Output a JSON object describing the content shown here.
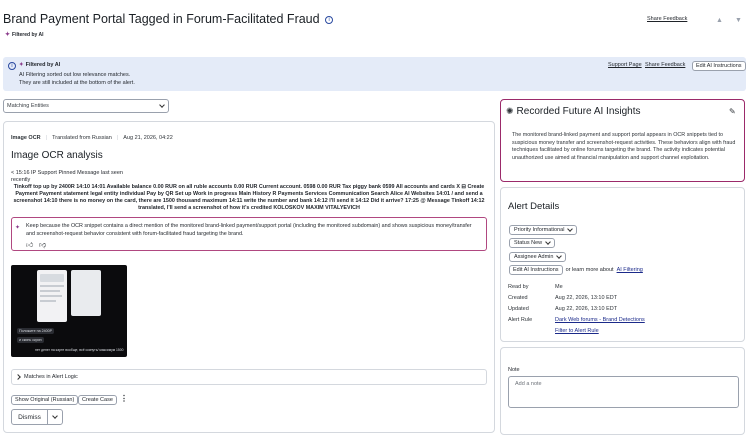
{
  "header": {
    "title": "Brand Payment Portal Tagged in Forum-Facilitated Fraud",
    "share_feedback": "Share Feedback",
    "filtered_by_ai": "Filtered by AI"
  },
  "banner": {
    "title": "Filtered by AI",
    "line1": "AI Filtering sorted out low relevance matches.",
    "line2": "They are still included at the bottom of the alert.",
    "support_page": "Support Page",
    "share_feedback": "Share Feedback",
    "edit_ai_instructions": "Edit AI Instructions"
  },
  "matching_entities": {
    "placeholder": "Matching Entities"
  },
  "ocr": {
    "tag": "Image OCR",
    "translated": "Translated from Russian",
    "date": "Aug 21, 2026, 04:22",
    "title": "Image OCR analysis",
    "line1": "< 15:16 IP Support Pinned Message last seen",
    "line2": "recently",
    "bold_text": "Tinkoff top up by 2400R 14:10 14:01 Available balance 0.00 RUR on all ruble accounts 0.00 RUR Current account. 0598 0.00 RUR Tax piggy bank 0599 All accounts and cards X ⊟ Create Payment Payment statement legal entity individual Pay by QR Set up Work in progress Main History R Payments Services Communication                    Search Alice AI Websites 14:01 / and send a screenshot 14:10 there is no money on the card, there are 1500 thousand maximum 14:11 write the number and bank 14:12 I'll send it 14:12 Did it arrive? 17:25 @ Message Tinkoff 14:12 translated, I'll send a screenshot of how it's credited KOLOSKOV MAXIM VITALYEVICH",
    "keep_text": "Keep because the OCR snippet contains a direct mention of the monitored brand-linked payment/support portal (including the monitored subdomain) and shows suspicious money/transfer and screenshot-request behavior consistent with forum-facilitated fraud targeting the brand.",
    "phone_line1": "Положите на 2400Р",
    "phone_line2": "и скинь скрин",
    "phone_line3": "нет денег на карте вообще, всё скинуть/ максимум 1500"
  },
  "matches_logic": "Matches in Alert Logic",
  "footer": {
    "show_original": "Show Original (Russian)",
    "create_case": "Create Case",
    "dismiss": "Dismiss"
  },
  "insights": {
    "title": "Recorded Future AI Insights",
    "body": "The monitored brand-linked payment and support portal appears in OCR snippets tied to suspicious money transfer and screenshot-request activities. These behaviors align with fraud techniques facilitated by online forums targeting the brand. The activity indicates potential unauthorized use aimed at financial manipulation and support channel exploitation."
  },
  "alert_details": {
    "title": "Alert Details",
    "priority": "Priority Informational",
    "status": "Status New",
    "assignee": "Assignee Admin",
    "edit_ai": "Edit AI Instructions",
    "learn_more": "or learn more about",
    "ai_filtering": "AI Filtering",
    "rows": [
      {
        "label": "Read by",
        "value": "Me"
      },
      {
        "label": "Created",
        "value": "Aug 22, 2026, 13:10 EDT"
      },
      {
        "label": "Updated",
        "value": "Aug 22, 2026, 13:10 EDT"
      },
      {
        "label": "Alert Rule",
        "value": "Dark Web forums - Brand Detections"
      }
    ],
    "filter_rule": "Filter to Alert Rule"
  },
  "note": {
    "title": "Note",
    "placeholder": "Add a note"
  },
  "colors": {
    "banner_bg": "#e4ebf8",
    "insights_border": "#9b2a6a",
    "keep_border": "#b04880",
    "link": "#1b2a8a"
  }
}
